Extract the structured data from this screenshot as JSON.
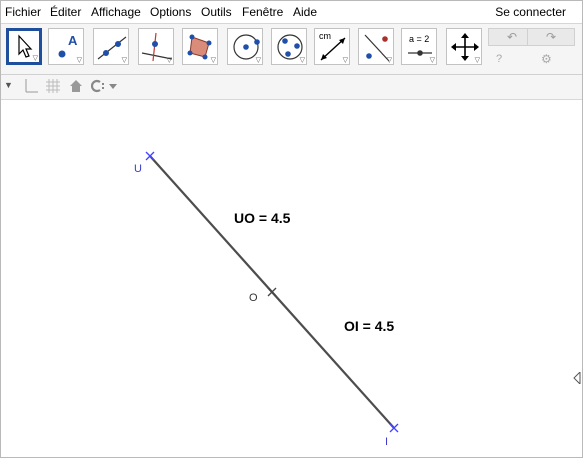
{
  "menubar": {
    "items": [
      "Fichier",
      "Éditer",
      "Affichage",
      "Options",
      "Outils",
      "Fenêtre",
      "Aide"
    ],
    "signin_label": "Se connecter"
  },
  "toolbar": {
    "tools": [
      {
        "name": "move-tool",
        "icon": "arrow-pointer-icon",
        "selected": true
      },
      {
        "name": "point-tool",
        "icon": "point-A-icon",
        "text": "A"
      },
      {
        "name": "line-tool",
        "icon": "line-through-points-icon"
      },
      {
        "name": "perpendicular-line-tool",
        "icon": "perpendicular-line-icon"
      },
      {
        "name": "polygon-tool",
        "icon": "polygon-icon"
      },
      {
        "name": "circle-tool",
        "icon": "circle-center-point-icon"
      },
      {
        "name": "circle-three-points-tool",
        "icon": "circle-three-points-icon"
      },
      {
        "name": "distance-tool",
        "icon": "distance-measure-icon",
        "text": "cm"
      },
      {
        "name": "reflect-tool",
        "icon": "reflect-about-line-icon"
      },
      {
        "name": "slider-tool",
        "icon": "slider-icon",
        "text": "a = 2"
      },
      {
        "name": "move-view-tool",
        "icon": "move-graphics-view-icon"
      }
    ],
    "undo_icon": "undo-icon",
    "redo_icon": "redo-icon",
    "help_icon": "help-icon",
    "settings_icon": "gear-icon"
  },
  "stylebar": {
    "toggle_icon": "triangle-down-icon",
    "axes_icon": "axes-icon",
    "grid_icon": "grid-icon",
    "home_icon": "home-icon",
    "point_capture_icon": "point-capture-icon"
  },
  "graphics": {
    "points": [
      {
        "name": "U",
        "label": "U"
      },
      {
        "name": "O",
        "label": "O"
      },
      {
        "name": "I",
        "label": "I"
      }
    ],
    "texts": [
      {
        "name": "uo-length-text",
        "value": "UO = 4.5"
      },
      {
        "name": "oi-length-text",
        "value": "OI = 4.5"
      }
    ],
    "colors": {
      "segment": "#4d4d4d",
      "point_marker": "#4444ff",
      "midpoint_marker": "#444444",
      "selected_tool_border": "#1f4f9c"
    }
  }
}
